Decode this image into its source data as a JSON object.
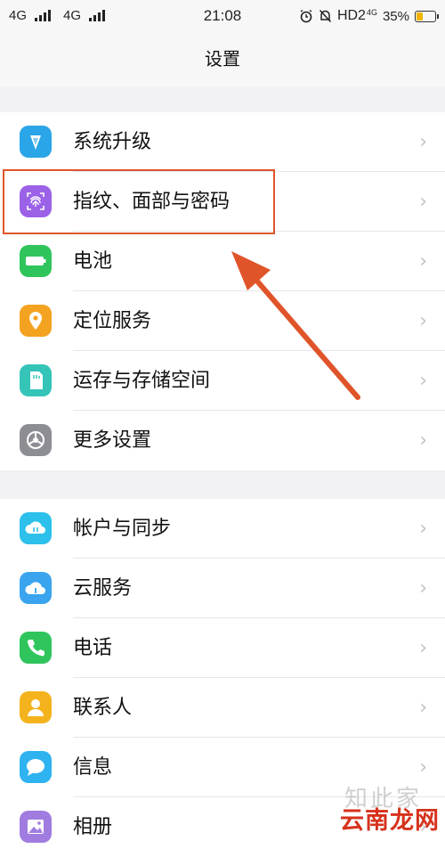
{
  "status_bar": {
    "signal_1": "4G",
    "signal_2": "4G",
    "time": "21:08",
    "network": "HD2",
    "net_small": "4G",
    "battery_percent": "35%",
    "battery_level": 0.35,
    "icons": [
      "alarm-icon",
      "mute-icon"
    ]
  },
  "header": {
    "title": "设置"
  },
  "groups": [
    {
      "items": [
        {
          "label": "系统升级",
          "icon": "system-update-icon",
          "color": "#2aa5e8"
        },
        {
          "label": "指纹、面部与密码",
          "icon": "fingerprint-icon",
          "color": "#9b62e8"
        },
        {
          "label": "电池",
          "icon": "battery-icon",
          "color": "#2fc55c"
        },
        {
          "label": "定位服务",
          "icon": "location-icon",
          "color": "#f4a321"
        },
        {
          "label": "运存与存储空间",
          "icon": "storage-icon",
          "color": "#34c4b8"
        },
        {
          "label": "更多设置",
          "icon": "more-settings-icon",
          "color": "#8d8d94"
        }
      ]
    },
    {
      "items": [
        {
          "label": "帐户与同步",
          "icon": "account-sync-icon",
          "color": "#2cc0ea"
        },
        {
          "label": "云服务",
          "icon": "cloud-icon",
          "color": "#3aa4ee"
        },
        {
          "label": "电话",
          "icon": "phone-icon",
          "color": "#2fc55c"
        },
        {
          "label": "联系人",
          "icon": "contacts-icon",
          "color": "#f4b31d"
        },
        {
          "label": "信息",
          "icon": "message-icon",
          "color": "#2fb3f0"
        },
        {
          "label": "相册",
          "icon": "album-icon",
          "color": "#a07ce0"
        }
      ]
    }
  ],
  "chevron": "›",
  "annotation": {
    "highlight_color": "#e0542a"
  },
  "watermark": {
    "ghost_text": "知此家",
    "main_text": "云南龙网"
  }
}
